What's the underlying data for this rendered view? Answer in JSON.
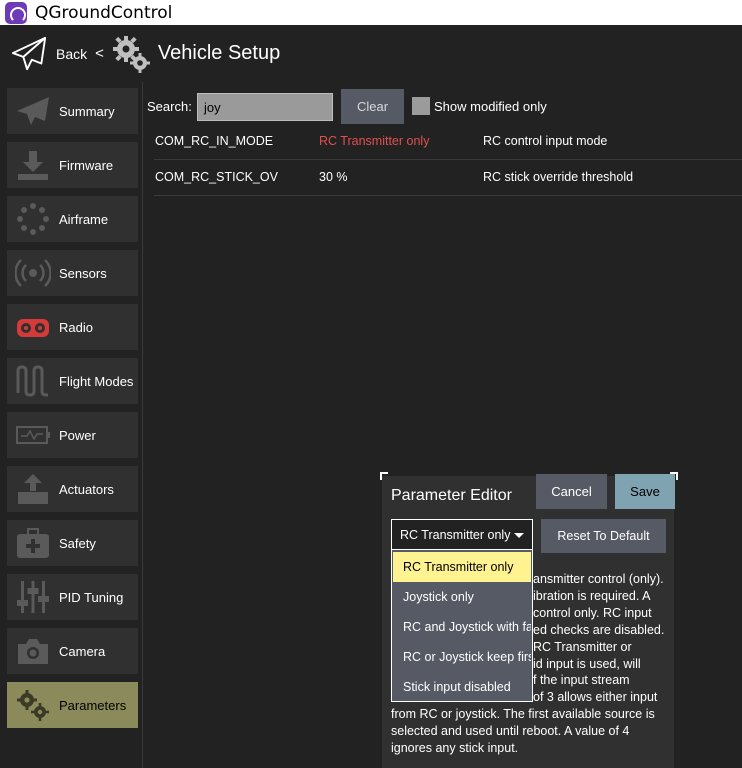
{
  "window": {
    "title": "QGroundControl"
  },
  "header": {
    "back_label": "Back",
    "chevron": "<",
    "title": "Vehicle Setup"
  },
  "sidebar": {
    "items": [
      {
        "label": "Summary",
        "icon": "paper-plane-icon"
      },
      {
        "label": "Firmware",
        "icon": "download-icon"
      },
      {
        "label": "Airframe",
        "icon": "airframe-dots-icon"
      },
      {
        "label": "Sensors",
        "icon": "sensors-icon"
      },
      {
        "label": "Radio",
        "icon": "radio-transmitter-icon"
      },
      {
        "label": "Flight Modes",
        "icon": "flight-modes-icon"
      },
      {
        "label": "Power",
        "icon": "battery-icon"
      },
      {
        "label": "Actuators",
        "icon": "actuators-icon"
      },
      {
        "label": "Safety",
        "icon": "first-aid-kit-icon"
      },
      {
        "label": "PID Tuning",
        "icon": "sliders-icon"
      },
      {
        "label": "Camera",
        "icon": "camera-icon"
      },
      {
        "label": "Parameters",
        "icon": "gears-icon",
        "active": true
      }
    ]
  },
  "search": {
    "label": "Search:",
    "value": "joy",
    "clear_label": "Clear",
    "show_modified_label": "Show modified only",
    "show_modified_checked": false
  },
  "params": [
    {
      "name": "COM_RC_IN_MODE",
      "value": "RC Transmitter only",
      "description": "RC control input mode",
      "modified": true
    },
    {
      "name": "COM_RC_STICK_OV",
      "value": "30 %",
      "description": "RC stick override threshold",
      "modified": false
    }
  ],
  "editor": {
    "title": "Parameter Editor",
    "cancel_label": "Cancel",
    "save_label": "Save",
    "selected_value": "RC Transmitter only",
    "reset_label": "Reset To Default",
    "help_lines": [
      "ansmitter control (only).",
      "ibration is required. A",
      "control only. RC input",
      "ed checks are disabled.",
      "RC Transmitter or",
      "id input is used, will",
      "f the input stream",
      "of 3 allows either input",
      "from RC or joystick. The first available source is",
      "selected and used until reboot. A value of 4",
      "ignores any stick input."
    ]
  },
  "dropdown": {
    "options": [
      {
        "label": "RC Transmitter only",
        "selected": true
      },
      {
        "label": "Joystick only",
        "selected": false
      },
      {
        "label": "RC and Joystick with fallback",
        "selected": false
      },
      {
        "label": "RC or Joystick keep first",
        "selected": false
      },
      {
        "label": "Stick input disabled",
        "selected": false
      }
    ]
  },
  "colors": {
    "active_nav": "#8a8a5a",
    "modified_value": "#e05050",
    "save_button": "#7fa3b0",
    "selected_option": "#fff291",
    "button_bg": "#555a64"
  }
}
